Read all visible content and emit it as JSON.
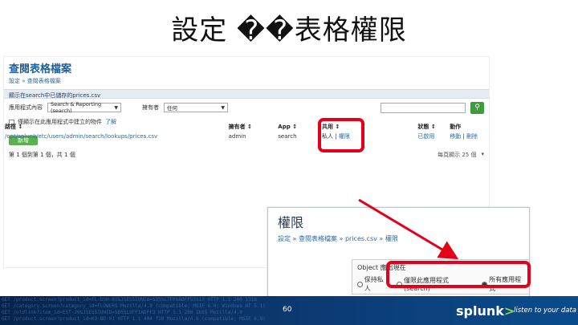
{
  "slide": {
    "title": "設定 ��表格權限",
    "page_number": "60"
  },
  "screenshot": {
    "title": "查閱表格檔案",
    "breadcrumb": "設定 » 查閱表格檔案",
    "subbar": "顯示在search中已儲存的prices.csv",
    "filters": {
      "app_label": "應用程式內容",
      "app_value": "Search & Reporting (search)",
      "owner_label": "擁有者",
      "owner_value": "任何"
    },
    "checkbox_label": "僅顯示在此應用程式中建立的物件",
    "checkbox_link": "了解",
    "new_button": "新增",
    "count_text": "第 1 個到第 1 個，共 1 個",
    "per_page": "每頁顯示 25 個",
    "table": {
      "headers": [
        "路徑 ↕",
        "擁有者 ↕",
        "App ↕",
        "共用 ↕",
        "狀態 ↕",
        "動作"
      ],
      "rows": [
        {
          "path": "/opt/splunk/etc/users/admin/search/lookups/prices.csv",
          "owner": "admin",
          "app": "search",
          "sharing_private": "私人",
          "sharing_perm": "權限",
          "status": "已啟用",
          "action_move": "移動",
          "action_delete": "刪除"
        }
      ]
    }
  },
  "permissions": {
    "title": "權限",
    "breadcrumb": "設定 » 查閱表格檔案 » prices.csv » 權限",
    "box_label": "Object 應出現在",
    "radio_private": "保持私人",
    "radio_app": "僅限此應用程式 (search)",
    "radio_all": "所有應用程式"
  },
  "footer": {
    "brand": "splunk",
    "brand_mark": ">",
    "tagline": "listen to your data"
  },
  "colors": {
    "highlight": "#e4001b",
    "footer_dark": "#05244d",
    "brand_accent": "#8fd14f"
  }
}
